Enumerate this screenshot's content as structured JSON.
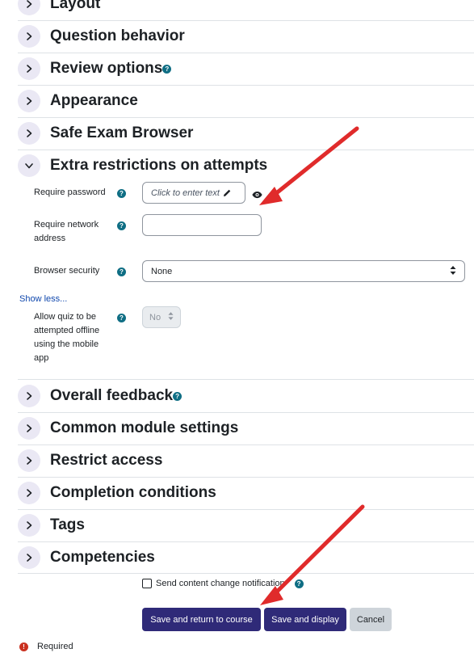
{
  "sections_top": [
    {
      "label": "Layout",
      "expanded": false,
      "help": false
    },
    {
      "label": "Question behavior",
      "expanded": false,
      "help": false
    },
    {
      "label": "Review options",
      "expanded": false,
      "help": true
    },
    {
      "label": "Appearance",
      "expanded": false,
      "help": false
    },
    {
      "label": "Safe Exam Browser",
      "expanded": false,
      "help": false
    },
    {
      "label": "Extra restrictions on attempts",
      "expanded": true,
      "help": false
    }
  ],
  "restrictions": {
    "password_label": "Require password",
    "password_placeholder": "Click to enter text",
    "network_label_line1": "Require network",
    "network_label_line2": "address",
    "network_value": "",
    "browser_label": "Browser security",
    "browser_value": "None",
    "show_less": "Show less...",
    "offline_label_line1": "Allow quiz to be",
    "offline_label_line2": "attempted offline",
    "offline_label_line3": "using the mobile",
    "offline_label_line4": "app",
    "offline_value": "No"
  },
  "sections_bottom": [
    {
      "label": "Overall feedback",
      "expanded": false,
      "help": true
    },
    {
      "label": "Common module settings",
      "expanded": false,
      "help": false
    },
    {
      "label": "Restrict access",
      "expanded": false,
      "help": false
    },
    {
      "label": "Completion conditions",
      "expanded": false,
      "help": false
    },
    {
      "label": "Tags",
      "expanded": false,
      "help": false
    },
    {
      "label": "Competencies",
      "expanded": false,
      "help": false
    }
  ],
  "notify_label": "Send content change notification",
  "buttons": {
    "save_return": "Save and return to course",
    "save_display": "Save and display",
    "cancel": "Cancel"
  },
  "required_label": "Required",
  "help_glyph": "?",
  "colors": {
    "accent": "#2f2a78",
    "help": "#0f6e84",
    "arrow": "#e02b2b",
    "required": "#ca3120"
  }
}
